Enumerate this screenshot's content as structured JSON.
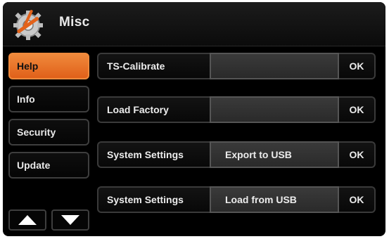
{
  "header": {
    "title": "Misc",
    "logo_icon": "gear-wrench-screwdriver-icon"
  },
  "sidebar": {
    "items": [
      {
        "label": "Help",
        "active": true
      },
      {
        "label": "Info",
        "active": false
      },
      {
        "label": "Security",
        "active": false
      },
      {
        "label": "Update",
        "active": false
      }
    ],
    "up_icon": "triangle-up-icon",
    "down_icon": "triangle-down-icon"
  },
  "rows": [
    {
      "label": "TS-Calibrate",
      "value": "",
      "ok": "OK"
    },
    {
      "label": "Load Factory",
      "value": "",
      "ok": "OK"
    },
    {
      "label": "System Settings",
      "value": "Export to USB",
      "ok": "OK"
    },
    {
      "label": "System Settings",
      "value": "Load from USB",
      "ok": "OK"
    }
  ],
  "colors": {
    "accent": "#f07a2c",
    "background": "#000000",
    "field": "#333333"
  }
}
